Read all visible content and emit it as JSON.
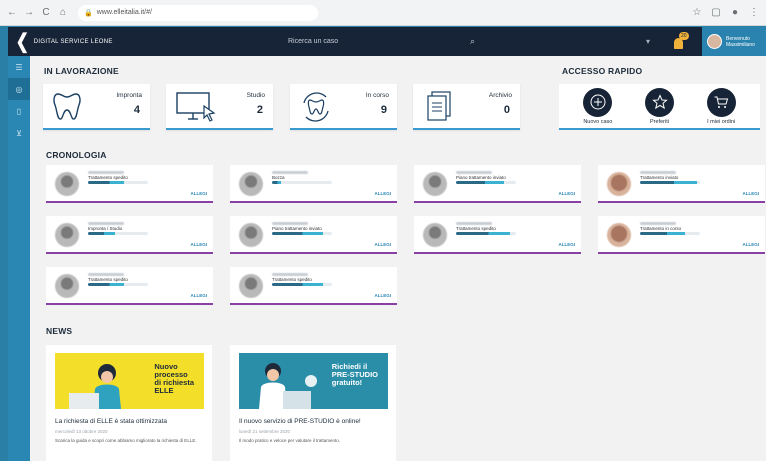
{
  "browser": {
    "url": "www.elleitalia.it/#/",
    "nav": [
      "←",
      "→",
      "C",
      "⌂"
    ]
  },
  "header": {
    "brand": "DIGITAL SERVICE LEONE",
    "search_placeholder": "Ricerca un caso",
    "dropdown_icon": "▾",
    "notification_count": "20",
    "user_name_line1": "Benvenuto",
    "user_name_line2": "Massimiliano"
  },
  "sections": {
    "in_progress": "IN LAVORAZIONE",
    "quick_access": "ACCESSO RAPIDO",
    "history": "CRONOLOGIA",
    "news": "NEWS"
  },
  "stats": [
    {
      "label": "Impronta",
      "value": "4",
      "icon": "tooth-icon"
    },
    {
      "label": "Studio",
      "value": "2",
      "icon": "monitor-icon"
    },
    {
      "label": "In corso",
      "value": "9",
      "icon": "tooth-cycle-icon"
    },
    {
      "label": "Archivio",
      "value": "0",
      "icon": "documents-icon"
    }
  ],
  "quick": [
    {
      "label": "Nuovo caso",
      "icon": "plus-icon"
    },
    {
      "label": "Preferiti",
      "icon": "star-icon"
    },
    {
      "label": "I miei ordini",
      "icon": "cart-icon"
    }
  ],
  "history": [
    {
      "status": "Trattamento spedito",
      "progress": 0.6,
      "link": "ALLEGI",
      "photo": false
    },
    {
      "status": "Bozza",
      "progress": 0.15,
      "link": "ALLEGI",
      "photo": false
    },
    {
      "status": "Piano trattamento inviato",
      "progress": 0.8,
      "link": "ALLEGI",
      "photo": false
    },
    {
      "status": "Trattamento inviato",
      "progress": 0.95,
      "link": "ALLEGI",
      "photo": true
    },
    {
      "status": "Impronta / Studio",
      "progress": 0.45,
      "link": "ALLEGI",
      "photo": false
    },
    {
      "status": "Piano trattamento inviato",
      "progress": 0.85,
      "link": "ALLEGI",
      "photo": false
    },
    {
      "status": "Trattamento spedito",
      "progress": 0.9,
      "link": "ALLEGI",
      "photo": false
    },
    {
      "status": "Trattamento in corso",
      "progress": 0.75,
      "link": "ALLEGI",
      "photo": true
    },
    {
      "status": "Trattamento spedito",
      "progress": 0.6,
      "link": "ALLEGI",
      "photo": false
    },
    {
      "status": "Trattamento spedito",
      "progress": 0.85,
      "link": "ALLEGI",
      "photo": false
    }
  ],
  "news": [
    {
      "banner": "Nuovo\nprocesso\ndi richiesta\nELLE",
      "banner_bg": "#f3df2a",
      "title": "La richiesta di ELLE è stata ottimizzata",
      "date": "mercoledì 13 ottobre 2020",
      "desc": "Scarica la guida e scopri come abbiamo migliorato la richiesta di ELLE."
    },
    {
      "banner": "Richiedi il\nPRE-STUDIO\ngratuito!",
      "banner_bg": "#2a8ea9",
      "title": "Il nuovo servizio di PRE-STUDIO è online!",
      "date": "lunedì 21 settembre 2020",
      "desc": "Il modo pratico e veloce per valutare il trattamento."
    }
  ],
  "colors": {
    "accent": "#2a86b3",
    "dark": "#172336",
    "history_border": "#8a3fa5"
  }
}
